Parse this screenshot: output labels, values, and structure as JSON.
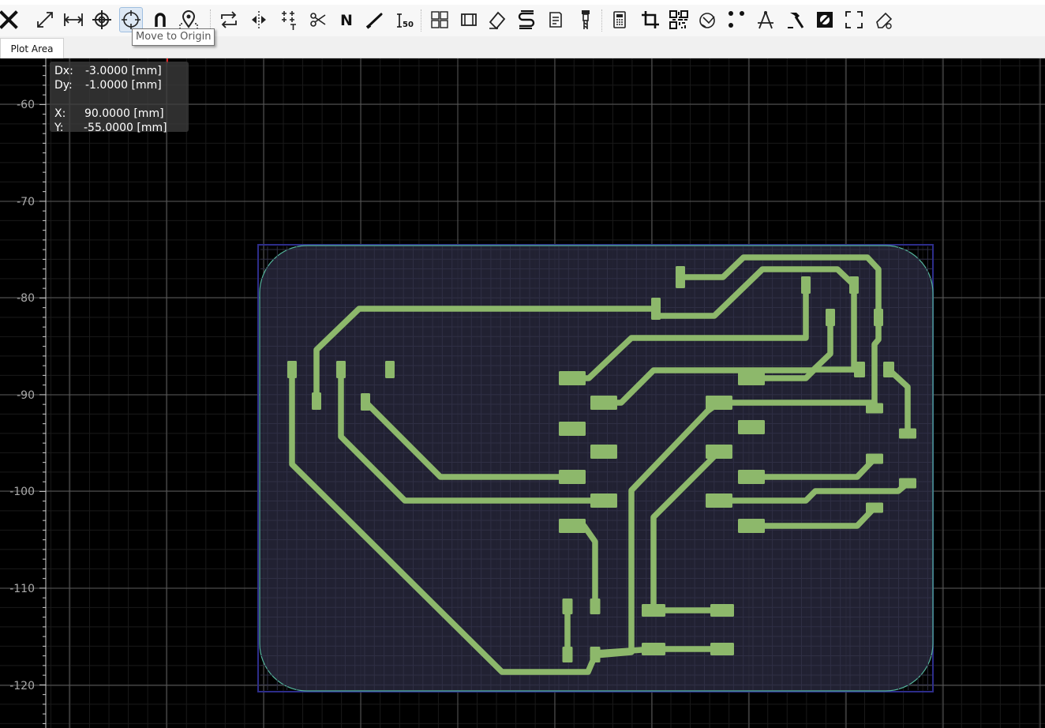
{
  "toolbar": {
    "tooltip": "Move to Origin",
    "buttons": [
      {
        "name": "delete-button",
        "icon": "x-close-icon"
      },
      {
        "name": "resize-button",
        "icon": "diagonal-arrows-icon"
      },
      {
        "name": "distance-button",
        "icon": "distance-measure-icon"
      },
      {
        "name": "set-origin-button",
        "icon": "crosshair-target-icon"
      },
      {
        "name": "move-to-origin-button",
        "icon": "origin-circle-icon",
        "active": true
      },
      {
        "name": "snap-button",
        "icon": "magnet-icon"
      },
      {
        "name": "locate-button",
        "icon": "map-pin-icon"
      },
      {
        "name": "transform-button",
        "icon": "loop-arrows-icon"
      },
      {
        "name": "mirror-button",
        "icon": "mirror-icon"
      },
      {
        "name": "align-button",
        "icon": "align-points-icon"
      },
      {
        "name": "cut-button",
        "icon": "scissors-icon"
      },
      {
        "name": "north-button",
        "icon": "letter-n-icon"
      },
      {
        "name": "draw-line-button",
        "icon": "pen-stroke-icon"
      },
      {
        "name": "iso-button",
        "icon": "iso-icon"
      },
      {
        "name": "panelize-button",
        "icon": "panel-grid-icon"
      },
      {
        "name": "film-button",
        "icon": "film-icon"
      },
      {
        "name": "paint-button",
        "icon": "paint-diamond-icon"
      },
      {
        "name": "copper-thieving-button",
        "icon": "s-curve-icon"
      },
      {
        "name": "report-button",
        "icon": "document-icon"
      },
      {
        "name": "milling-button",
        "icon": "milling-tool-icon"
      },
      {
        "name": "calculator-button",
        "icon": "calculator-icon"
      },
      {
        "name": "crop-button",
        "icon": "crop-icon"
      },
      {
        "name": "qrcode-button",
        "icon": "qr-code-icon"
      },
      {
        "name": "rules-check-button",
        "icon": "rules-check-icon"
      },
      {
        "name": "points-button",
        "icon": "dots-icon"
      },
      {
        "name": "compass-button",
        "icon": "compass-icon"
      },
      {
        "name": "hammer-button",
        "icon": "hammer-icon"
      },
      {
        "name": "invert-button",
        "icon": "invert-square-icon"
      },
      {
        "name": "fullscreen-button",
        "icon": "corners-icon"
      },
      {
        "name": "extract-button",
        "icon": "eraser-icon"
      }
    ]
  },
  "tabs": [
    {
      "label": "Plot Area"
    }
  ],
  "info": {
    "dx_label": "Dx:",
    "dx_value": "-3.0000 [mm]",
    "dy_label": "Dy:",
    "dy_value": "-1.0000 [mm]",
    "x_label": "X:",
    "x_value": "90.0000 [mm]",
    "y_label": "Y:",
    "y_value": "-55.0000 [mm]"
  },
  "axis": {
    "y_ticks": [
      "-60",
      "-70",
      "-80",
      "-90",
      "-100",
      "-110",
      "-120"
    ]
  },
  "colors": {
    "background": "#000000",
    "grid": "#5a5a5a",
    "board_fill": "#242436",
    "board_outline": "#54b49c",
    "copper": "#8db86b",
    "selection_frame": "#2d2d8a"
  }
}
